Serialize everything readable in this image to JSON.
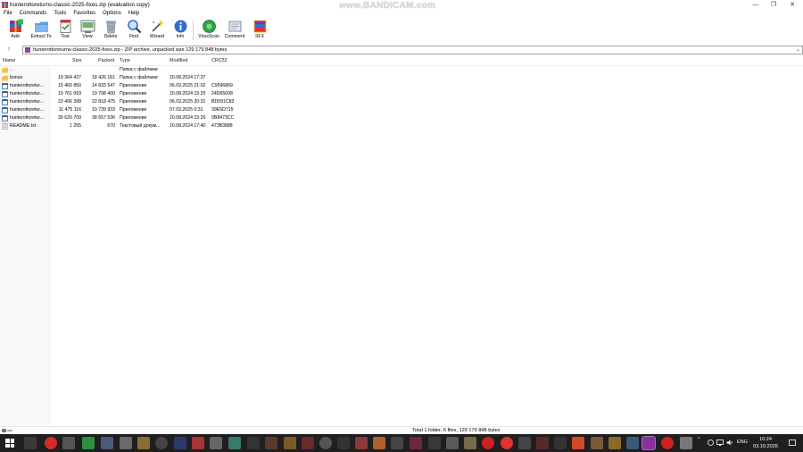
{
  "window": {
    "title": "hunterottoreturns-classic-2025-fixes.zip (evaluation copy)",
    "watermark": "www.BANDICAM.com",
    "min_glyph": "—",
    "max_glyph": "❐",
    "close_glyph": "✕"
  },
  "menu": [
    "File",
    "Commands",
    "Tools",
    "Favorites",
    "Options",
    "Help"
  ],
  "toolbar": [
    {
      "label": "Add",
      "icon": "add-archive-icon"
    },
    {
      "label": "Extract To",
      "icon": "extract-folder-icon"
    },
    {
      "label": "Test",
      "icon": "test-checklist-icon"
    },
    {
      "label": "View",
      "icon": "view-document-icon"
    },
    {
      "label": "Delete",
      "icon": "trash-icon"
    },
    {
      "label": "Find",
      "icon": "magnifier-icon"
    },
    {
      "label": "Wizard",
      "icon": "wand-icon"
    },
    {
      "label": "Info",
      "icon": "info-icon"
    },
    {
      "label": "VirusScan",
      "icon": "virus-scan-icon"
    },
    {
      "label": "Comment",
      "icon": "comment-icon"
    },
    {
      "label": "SFX",
      "icon": "sfx-archive-icon"
    }
  ],
  "address": {
    "up_glyph": "↑",
    "path": "hunterottoreturns-classic-2025-fixes.zip - ZIP archive, unpacked size 129 179 848 bytes",
    "drop_glyph": "⌄"
  },
  "columns": {
    "name": "Name",
    "size": "Size",
    "packed": "Packed",
    "type": "Type",
    "modified": "Modified",
    "crc": "CRC32"
  },
  "rows": [
    {
      "name": "..",
      "size": "",
      "packed": "",
      "type": "Папка с файлами",
      "modified": "",
      "crc": "",
      "kind": "folder"
    },
    {
      "name": "bonus",
      "size": "19 364 427",
      "packed": "18 426 161",
      "type": "Папка с файлами",
      "modified": "20.08.2024 17:37",
      "crc": "",
      "kind": "folder"
    },
    {
      "name": "hunterottoretur...",
      "size": "15 460 850",
      "packed": "14 833 547",
      "type": "Приложение",
      "modified": "06.03.2025 21:02",
      "crc": "C9596869",
      "kind": "app"
    },
    {
      "name": "hunterottoretur...",
      "size": "19 761 093",
      "packed": "19 798 400",
      "type": "Приложение",
      "modified": "20.08.2024 15:25",
      "crc": "24D65008",
      "kind": "app"
    },
    {
      "name": "hunterottoretur...",
      "size": "23 496 398",
      "packed": "22 818 475",
      "type": "Приложение",
      "modified": "06.03.2025 20:31",
      "crc": "BD091C83",
      "kind": "app"
    },
    {
      "name": "hunterottoretur...",
      "size": "11 475 116",
      "packed": "10 739 933",
      "type": "Приложение",
      "modified": "07.03.2025 0:31",
      "crc": "39E5D715",
      "kind": "app"
    },
    {
      "name": "hunterottoretur...",
      "size": "39 620 709",
      "packed": "38 657 536",
      "type": "Приложение",
      "modified": "20.08.2024 15:26",
      "crc": "0B8473CC",
      "kind": "app"
    },
    {
      "name": "README.txt",
      "size": "1 255",
      "packed": "670",
      "type": "Текстовый докум...",
      "modified": "20.08.2024 17:40",
      "crc": "473B3888",
      "kind": "text"
    }
  ],
  "status": {
    "text": "Total 1 folder, 6 files, 129 179 848 bytes"
  },
  "taskbar": {
    "tray_arrow": "^",
    "lang": "ENG",
    "time": "10:24",
    "date": "03.10.2025"
  },
  "colors": {
    "taskbar_bg": "#1f1f1f",
    "folder": "#f2c54a",
    "selection_header": "#ffffff"
  }
}
